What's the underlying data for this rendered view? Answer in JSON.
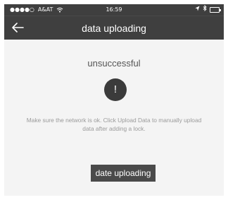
{
  "status_bar": {
    "carrier": "A&AT",
    "signal_dots": "●●●●○",
    "time": "16:59",
    "icons": [
      "wifi-icon",
      "location-arrow-icon",
      "bluetooth-icon",
      "battery-icon"
    ]
  },
  "nav": {
    "title": "data uploading",
    "back_icon": "back-arrow-icon"
  },
  "result": {
    "title": "unsuccessful",
    "alert_symbol": "!",
    "message": "Make sure the network is ok. Click Upload Data to manually upload data after adding a lock."
  },
  "actions": {
    "upload_button_label": "date uploading"
  },
  "colors": {
    "bar": "#3f3f3f",
    "background": "#f4f4f4",
    "alert_circle": "#3b3b3b",
    "button": "#4a4a4a"
  }
}
